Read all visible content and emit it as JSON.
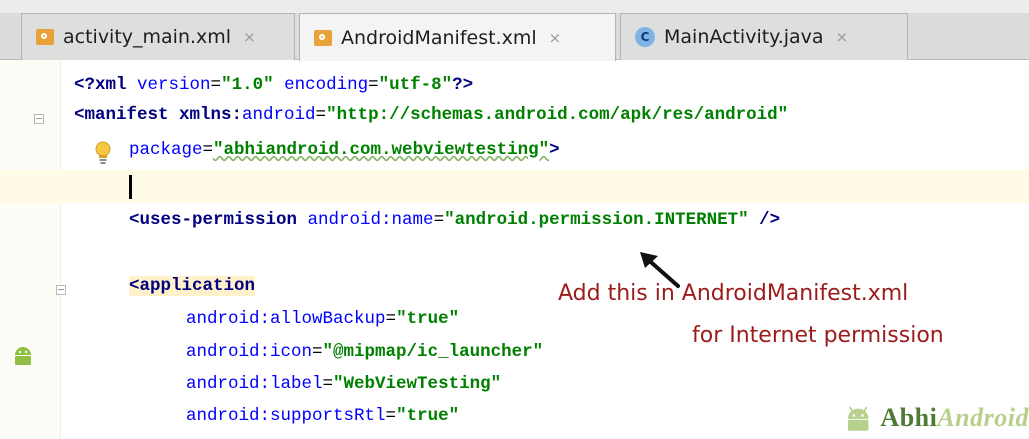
{
  "tabs": [
    {
      "label": "activity_main.xml",
      "close": "×",
      "icon": "xml-file-icon",
      "active": false
    },
    {
      "label": "AndroidManifest.xml",
      "close": "×",
      "icon": "xml-file-icon",
      "active": true
    },
    {
      "label": "MainActivity.java",
      "close": "×",
      "icon": "java-class-icon",
      "icon_letter": "C",
      "active": false
    }
  ],
  "code": {
    "line1": {
      "prolog_open": "<?",
      "prolog_name": "xml",
      "attr1": " version",
      "eq1": "=",
      "val1": "\"1.0\"",
      "attr2": " encoding",
      "eq2": "=",
      "val2": "\"utf-8\"",
      "prolog_close": "?>"
    },
    "line2": {
      "tag_open": "<manifest",
      "ns": " xmlns:",
      "ns_attr": "android",
      "eq": "=",
      "value": "\"http://schemas.android.com/apk/res/android\""
    },
    "line3": {
      "attr": "package",
      "eq": "=",
      "value": "\"abhiandroid.com.webviewtesting\"",
      "close": ">"
    },
    "line5": {
      "tag_open": "<uses-permission",
      "ns": " android:",
      "attr": "name",
      "eq": "=",
      "value": "\"android.permission.INTERNET\"",
      "close": " />"
    },
    "line7": {
      "tag_open": "<application"
    },
    "line8": {
      "ns": "android:",
      "attr": "allowBackup",
      "eq": "=",
      "value": "\"true\""
    },
    "line9": {
      "ns": "android:",
      "attr": "icon",
      "eq": "=",
      "value": "\"@mipmap/ic_launcher\""
    },
    "line10": {
      "ns": "android:",
      "attr": "label",
      "eq": "=",
      "value": "\"WebViewTesting\""
    },
    "line11": {
      "ns": "android:",
      "attr": "supportsRtl",
      "eq": "=",
      "value": "\"true\""
    }
  },
  "annotation": {
    "line1": "Add this in AndroidManifest.xml",
    "line2": "for Internet permission"
  },
  "watermark": {
    "text_dark": "Abhi",
    "text_light": "Android"
  },
  "colors": {
    "annotation": "#9c1b1b",
    "tag": "#000080",
    "string": "#008000",
    "attribute": "#660e7a",
    "namespace": "#0000ff"
  }
}
